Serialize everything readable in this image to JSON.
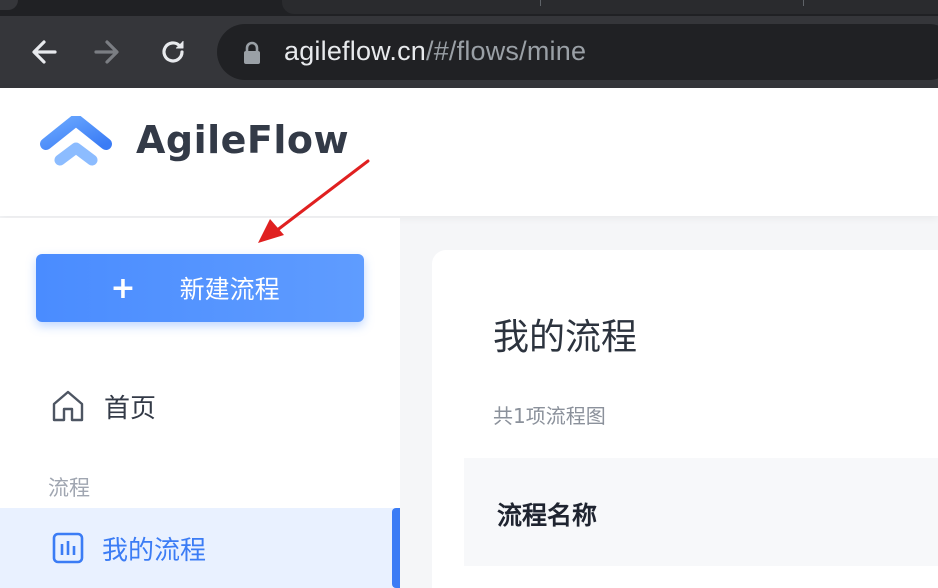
{
  "browser": {
    "url_host": "agileflow.cn",
    "url_path": "/#/flows/mine",
    "nav": {
      "back": "back-arrow-icon",
      "forward": "forward-arrow-icon",
      "reload": "reload-icon"
    }
  },
  "brand": {
    "name": "AgileFlow"
  },
  "sidebar": {
    "new_button_plus": "+",
    "new_button_label": "新建流程",
    "home_label": "首页",
    "section_label": "流程",
    "active_item_label": "我的流程"
  },
  "main": {
    "title": "我的流程",
    "count_text": "共1项流程图",
    "table": {
      "columns": [
        "流程名称"
      ]
    }
  },
  "colors": {
    "accent": "#3b7cf5",
    "button": "#4a8cff",
    "annotation_arrow": "#e02020"
  }
}
